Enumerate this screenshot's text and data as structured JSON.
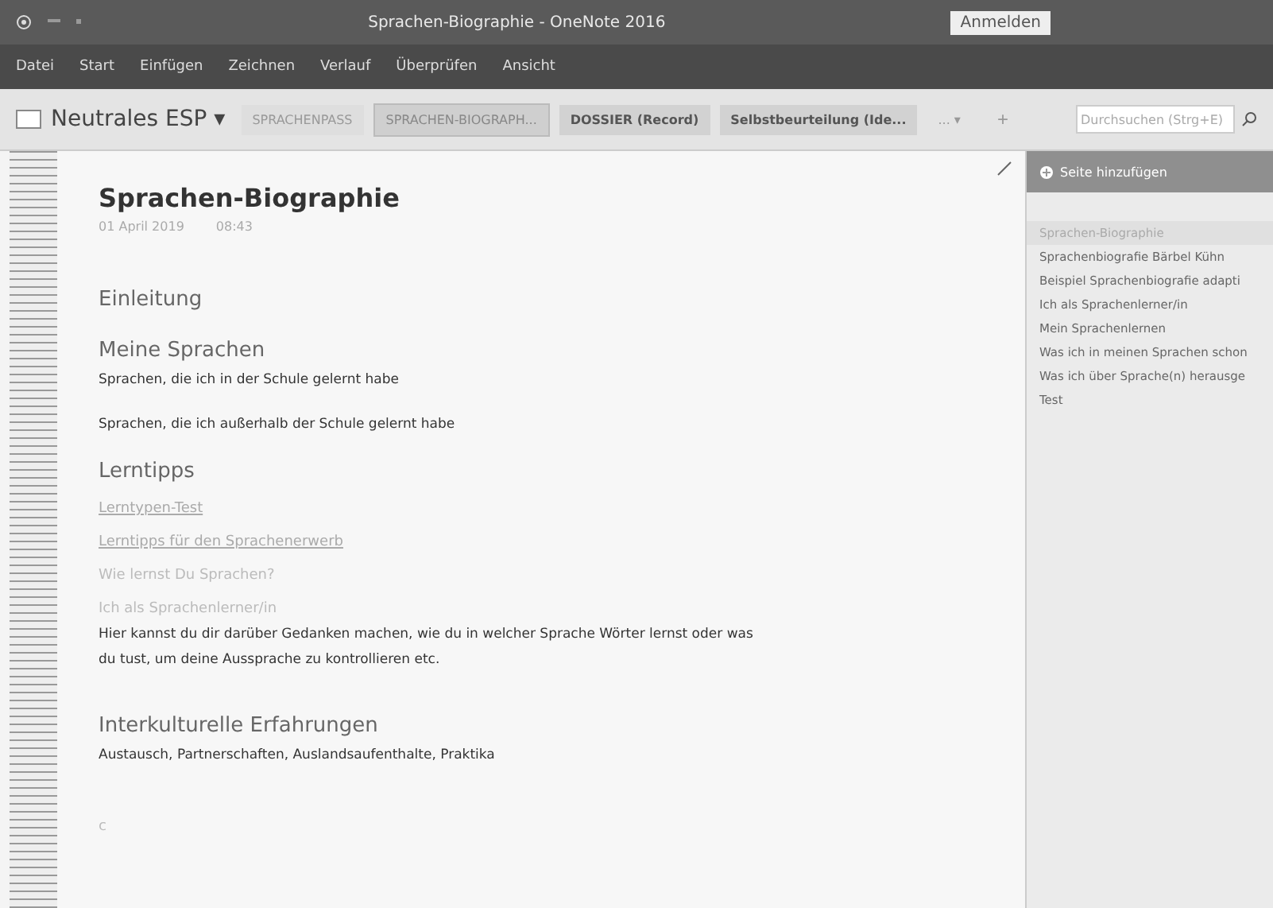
{
  "window": {
    "title": "Sprachen-Biographie - OneNote 2016",
    "signin": "Anmelden"
  },
  "menu": [
    "Datei",
    "Start",
    "Einfügen",
    "Zeichnen",
    "Verlauf",
    "Überprüfen",
    "Ansicht"
  ],
  "notebook": {
    "name": "Neutrales ESP",
    "caret": "▾"
  },
  "tabs": [
    {
      "label": "SPRACHENPASS",
      "selected": false,
      "kind": "caps"
    },
    {
      "label": "SPRACHEN-BIOGRAPH...",
      "selected": true,
      "kind": "caps"
    },
    {
      "label": "DOSSIER (Record)",
      "selected": false,
      "kind": "bold"
    },
    {
      "label": "Selbstbeurteilung (Ide...",
      "selected": false,
      "kind": "bold"
    },
    {
      "label": "... ▾",
      "selected": false,
      "kind": "more"
    }
  ],
  "add_tab": "+",
  "search": {
    "placeholder": "Durchsuchen (Strg+E)"
  },
  "page": {
    "title": "Sprachen-Biographie",
    "date": "01 April 2019",
    "time": "08:43",
    "blocks": [
      {
        "kind": "heading",
        "text": "Einleitung"
      },
      {
        "kind": "gap"
      },
      {
        "kind": "heading",
        "text": "Meine Sprachen"
      },
      {
        "kind": "body",
        "text": "Sprachen, die ich in der Schule gelernt habe"
      },
      {
        "kind": "gap"
      },
      {
        "kind": "body",
        "text": "Sprachen, die ich außerhalb der Schule gelernt habe"
      },
      {
        "kind": "gap"
      },
      {
        "kind": "heading",
        "text": "Lerntipps"
      },
      {
        "kind": "link",
        "text": "Lerntypen-Test"
      },
      {
        "kind": "link",
        "text": "Lerntipps für den Sprachenerwerb"
      },
      {
        "kind": "faded",
        "text": "Wie lernst Du Sprachen?"
      },
      {
        "kind": "faded",
        "text": "Ich als Sprachenlerner/in"
      },
      {
        "kind": "body",
        "text": "Hier kannst du dir darüber Gedanken machen, wie du in welcher Sprache Wörter lernst oder was du tust, um deine Aussprache zu kontrollieren etc."
      },
      {
        "kind": "gap"
      },
      {
        "kind": "gap"
      },
      {
        "kind": "heading",
        "text": "Interkulturelle Erfahrungen"
      },
      {
        "kind": "body",
        "text": "Austausch, Partnerschaften, Auslandsaufenthalte, Praktika"
      },
      {
        "kind": "gap"
      },
      {
        "kind": "gap"
      },
      {
        "kind": "faded",
        "text": "c"
      }
    ]
  },
  "sidebar": {
    "add_page": "Seite hinzufügen",
    "items": [
      {
        "label": "Sprachen-Biographie",
        "selected": true
      },
      {
        "label": "Sprachenbiografie Bärbel Kühn",
        "selected": false
      },
      {
        "label": "Beispiel Sprachenbiografie adapti",
        "selected": false
      },
      {
        "label": "Ich als Sprachenlerner/in",
        "selected": false
      },
      {
        "label": "Mein Sprachenlernen",
        "selected": false
      },
      {
        "label": "Was ich in meinen Sprachen schon",
        "selected": false
      },
      {
        "label": "Was ich über Sprache(n) herausge",
        "selected": false
      },
      {
        "label": "Test",
        "selected": false
      }
    ]
  }
}
